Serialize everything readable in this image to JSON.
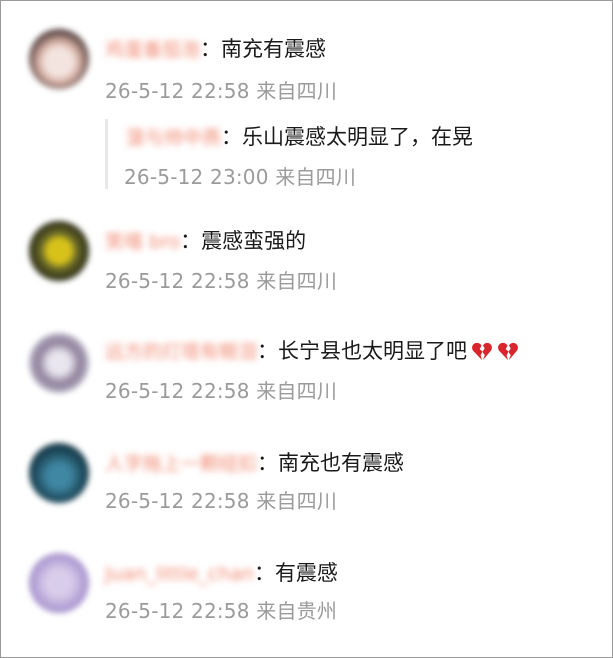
{
  "comments": [
    {
      "username": "鸡蛋番茄泡",
      "text": "南充有震感",
      "time": "26-5-12 22:58",
      "location": "来自四川",
      "avatar_colors": [
        "#3b2a2a",
        "#d9b3a8",
        "#f3e4df"
      ],
      "reply": {
        "username": "菠与帅中燕",
        "text": "乐山震感太明显了，在晃",
        "time": "26-5-12 23:00",
        "location": "来自四川"
      }
    },
    {
      "username": "笑嘻 bro",
      "text": "震感蛮强的",
      "time": "26-5-12 22:58",
      "location": "来自四川",
      "avatar_colors": [
        "#2c2c16",
        "#d7c21a",
        "#6b6b2a"
      ]
    },
    {
      "username": "远方的灯塔有眼泪",
      "text": "长宁县也太明显了吧",
      "time": "26-5-12 22:58",
      "location": "来自四川",
      "avatar_colors": [
        "#cfcfdc",
        "#8c7d98",
        "#e9e6ef"
      ],
      "emoji_name": "broken-heart-emoji",
      "emoji_count": 2
    },
    {
      "username": "人字拖上一颗纽扣",
      "text": "南充也有震感",
      "time": "26-5-12 22:58",
      "location": "来自四川",
      "avatar_colors": [
        "#1e4a5c",
        "#3f87a3",
        "#12303d"
      ]
    },
    {
      "username": "Juan_little_chan",
      "text": "有震感",
      "time": "26-5-12 22:58",
      "location": "来自贵州",
      "avatar_colors": [
        "#b8a6d8",
        "#d8cdea",
        "#9b86c4"
      ]
    }
  ],
  "colors": {
    "username": "#f08a72",
    "meta": "#9b9b9b",
    "text": "#1a1a1a",
    "emoji": "#d8262c"
  }
}
